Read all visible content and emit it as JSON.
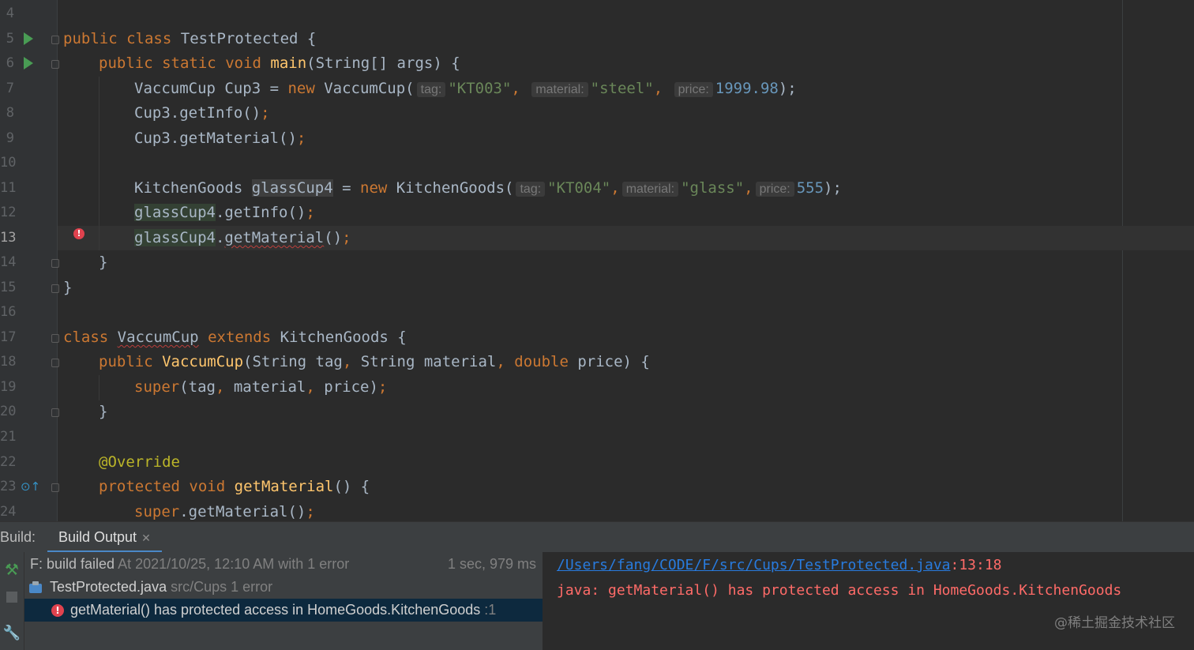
{
  "editor": {
    "line_numbers": [
      "4",
      "5",
      "6",
      "7",
      "8",
      "9",
      "10",
      "11",
      "12",
      "13",
      "14",
      "15",
      "16",
      "17",
      "18",
      "19",
      "20",
      "21",
      "22",
      "23",
      "24"
    ],
    "code": {
      "l5": {
        "kw1": "public",
        "kw2": "class",
        "name": "TestProtected",
        "tail": " {"
      },
      "l6": {
        "kw1": "public",
        "kw2": "static",
        "kw3": "void",
        "fn": "main",
        "tail": "(String[] args) {"
      },
      "l7": {
        "pre": "VaccumCup Cup3 = ",
        "kw": "new",
        "call": " VaccumCup(",
        "h1": "tag:",
        "s1": "\"KT003\"",
        "h2": "material:",
        "s2": "\"steel\"",
        "h3": "price:",
        "n": "1999.98",
        "end": ");"
      },
      "l8": {
        "text": "Cup3.getInfo()",
        "semi": ";"
      },
      "l9": {
        "text": "Cup3.getMaterial()",
        "semi": ";"
      },
      "l11": {
        "type": "KitchenGoods ",
        "var": "glassCup4",
        "eq": " = ",
        "kw": "new",
        "call": " KitchenGoods(",
        "h1": "tag:",
        "s1": "\"KT004\"",
        "h2": "material:",
        "s2": "\"glass\"",
        "h3": "price:",
        "n": "555",
        "end": ");"
      },
      "l12": {
        "var": "glassCup4",
        "rest": ".getInfo()",
        "semi": ";"
      },
      "l13": {
        "var": "glassCup4",
        "dot": ".",
        "method": "getMaterial",
        "rest": "()",
        "semi": ";"
      },
      "l14": {
        "text": "}"
      },
      "l15": {
        "text": "}"
      },
      "l17": {
        "kw1": "class",
        "name": "VaccumCup",
        "kw2": "extends",
        "parent": "KitchenGoods {"
      },
      "l18": {
        "kw1": "public",
        "fn": "VaccumCup",
        "p1": "(String tag",
        "c1": ",",
        "p2": " String material",
        "c2": ",",
        "kw2": "double",
        "p3": " price) {"
      },
      "l19": {
        "kw": "super",
        "args": "(tag",
        "c1": ",",
        "a2": " material",
        "c2": ",",
        "a3": " price)",
        "semi": ";"
      },
      "l20": {
        "text": "}"
      },
      "l22": {
        "ann": "@Override"
      },
      "l23": {
        "kw1": "protected",
        "kw2": "void",
        "fn": "getMaterial",
        "tail": "() {"
      },
      "l24": {
        "kw": "super",
        "rest": ".getMaterial()",
        "semi": ";"
      }
    }
  },
  "build": {
    "label": "Build:",
    "tab": "Build Output",
    "tree": {
      "row1_bold": "F: build failed",
      "row1_rest": "At 2021/10/25, 12:10 AM with 1 error",
      "row1_time": "1 sec, 979 ms",
      "row2_file": "TestProtected.java",
      "row2_rest": "src/Cups 1 error",
      "row3_msg": "getMaterial() has protected access in HomeGoods.KitchenGoods",
      "row3_loc": ":1"
    },
    "console": {
      "path": "/Users/fang/CODE/F/src/Cups/TestProtected.java",
      "pos": ":13:18",
      "error": "java: getMaterial() has protected access in HomeGoods.KitchenGoods"
    }
  },
  "watermark": "@稀土掘金技术社区"
}
